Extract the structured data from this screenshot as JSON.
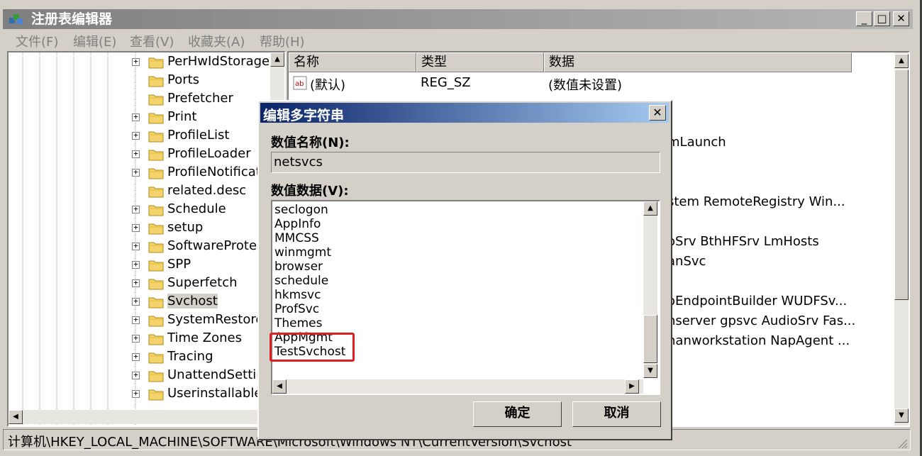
{
  "window": {
    "title": "注册表编辑器",
    "controls": {
      "minimize": "_",
      "maximize": "□",
      "close": "✕"
    }
  },
  "menu": {
    "items": [
      "文件(F)",
      "编辑(E)",
      "查看(V)",
      "收藏夹(A)",
      "帮助(H)"
    ]
  },
  "tree": {
    "items": [
      {
        "label": "PerHwIdStorage",
        "expandable": true
      },
      {
        "label": "Ports",
        "expandable": false
      },
      {
        "label": "Prefetcher",
        "expandable": false
      },
      {
        "label": "Print",
        "expandable": true
      },
      {
        "label": "ProfileList",
        "expandable": true
      },
      {
        "label": "ProfileLoader",
        "expandable": true
      },
      {
        "label": "ProfileNotificati",
        "expandable": true
      },
      {
        "label": "related.desc",
        "expandable": false
      },
      {
        "label": "Schedule",
        "expandable": true
      },
      {
        "label": "setup",
        "expandable": true
      },
      {
        "label": "SoftwareProtec",
        "expandable": true
      },
      {
        "label": "SPP",
        "expandable": true
      },
      {
        "label": "Superfetch",
        "expandable": true
      },
      {
        "label": "Svchost",
        "expandable": true,
        "selected": true
      },
      {
        "label": "SystemRestore",
        "expandable": true
      },
      {
        "label": "Time Zones",
        "expandable": true
      },
      {
        "label": "Tracing",
        "expandable": true
      },
      {
        "label": "UnattendSettin",
        "expandable": true
      },
      {
        "label": "Userinstallable.",
        "expandable": true
      }
    ]
  },
  "list": {
    "columns": [
      "名称",
      "类型",
      "数据"
    ],
    "rows": [
      {
        "name": "(默认)",
        "type": "REG_SZ",
        "data": "(数值未设置)"
      },
      {
        "name": "",
        "type": "",
        "data": "mLaunch"
      },
      {
        "name": "",
        "type": "",
        "data": "stem RemoteRegistry Win..."
      },
      {
        "name": "",
        "type": "",
        "data": "oSrv BthHFSrv LmHosts"
      },
      {
        "name": "",
        "type": "",
        "data": "anSvc"
      },
      {
        "name": "",
        "type": "",
        "data": "oEndpointBuilder WUDFSv..."
      },
      {
        "name": "",
        "type": "",
        "data": "nserver gpsvc AudioSrv Fas..."
      },
      {
        "name": "",
        "type": "",
        "data": "hanworkstation NapAgent ..."
      }
    ]
  },
  "statusbar": {
    "path": "计算机\\HKEY_LOCAL_MACHINE\\SOFTWARE\\Microsoft\\Windows NT\\CurrentVersion\\Svchost"
  },
  "dialog": {
    "title": "编辑多字符串",
    "close": "✕",
    "value_name_label": "数值名称(N):",
    "value_name": "netsvcs",
    "value_data_label": "数值数据(V):",
    "value_lines": [
      "seclogon",
      "AppInfo",
      "MMCSS",
      "winmgmt",
      "browser",
      "schedule",
      "hkmsvc",
      "ProfSvc",
      "Themes",
      "AppMgmt",
      "TestSvchost"
    ],
    "ok_label": "确定",
    "cancel_label": "取消"
  }
}
